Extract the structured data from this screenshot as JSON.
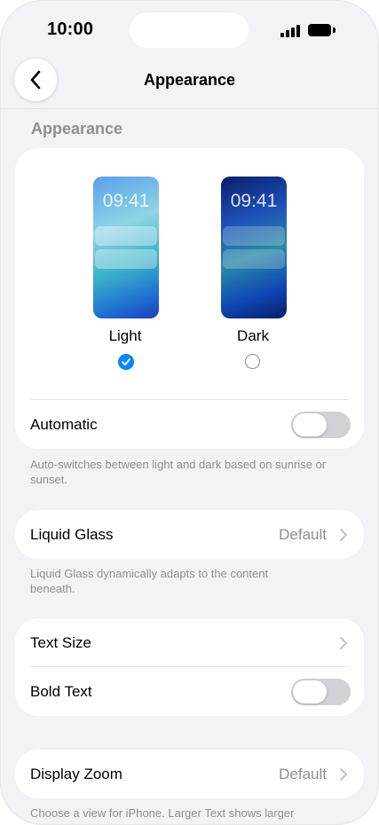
{
  "status_bar": {
    "time": "10:00"
  },
  "nav": {
    "title": "Appearance"
  },
  "appearance": {
    "section_header": "Appearance",
    "options": [
      {
        "preview_time": "09:41",
        "label": "Light",
        "selected": true
      },
      {
        "preview_time": "09:41",
        "label": "Dark",
        "selected": false
      }
    ],
    "automatic_label": "Automatic",
    "automatic_on": false,
    "footnote": "Auto-switches between light and dark based on sunrise or sunset."
  },
  "liquid_glass": {
    "label": "Liquid Glass",
    "value": "Default",
    "footnote": "Liquid Glass dynamically adapts to the content beneath."
  },
  "text": {
    "text_size_label": "Text Size",
    "bold_text_label": "Bold Text",
    "bold_text_on": false
  },
  "display_zoom": {
    "label": "Display Zoom",
    "value": "Default",
    "footnote": "Choose a view for iPhone. Larger Text shows larger"
  },
  "colors": {
    "accent": "#0a84ff",
    "toggle_off": "#d1d1d6",
    "secondary_text": "#8e8e93"
  }
}
